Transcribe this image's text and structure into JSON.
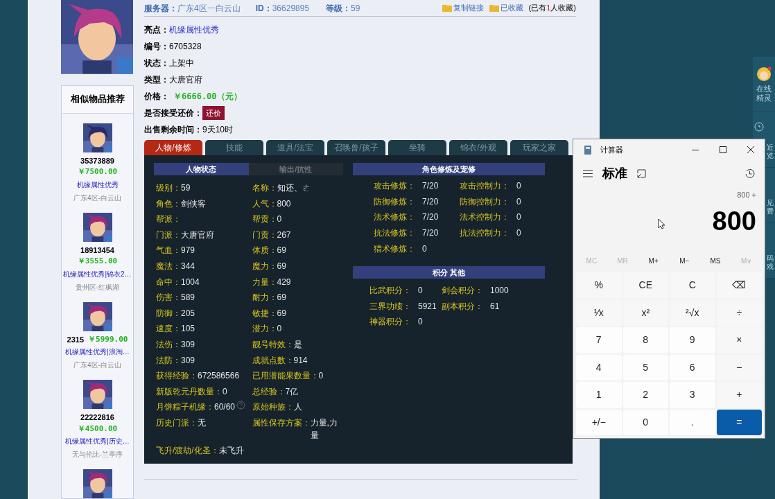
{
  "header": {
    "server_label": "服务器：",
    "server": "广东4区一白云山",
    "id_label": "ID：",
    "id": "36629895",
    "level_label": "等级：",
    "level": "59",
    "links": [
      "复制链接",
      "已收藏"
    ],
    "collect_before": "(已有",
    "collect_count": "1",
    "collect_after": "人收藏)"
  },
  "details": [
    {
      "kind": "link",
      "label": "亮点：",
      "value": "机缘属性优秀"
    },
    {
      "kind": "text",
      "label": "编号：",
      "value": "6705328"
    },
    {
      "kind": "text",
      "label": "状态：",
      "value": "上架中"
    },
    {
      "kind": "text",
      "label": "类型：",
      "value": "大唐官府"
    },
    {
      "kind": "price",
      "label": "价格：",
      "value": "￥6666.00（元）"
    },
    {
      "kind": "button",
      "label": "是否接受还价：",
      "value": "还价"
    },
    {
      "kind": "text",
      "label": "出售剩余时间：",
      "value": "9天10时"
    }
  ],
  "tabs": [
    {
      "label": "人物/修炼",
      "selected": true
    },
    {
      "label": "技能",
      "selected": false
    },
    {
      "label": "道具/法宝",
      "selected": false
    },
    {
      "label": "召唤兽/孩子",
      "selected": false
    },
    {
      "label": "坐骑",
      "selected": false
    },
    {
      "label": "锦衣/外观",
      "selected": false
    },
    {
      "label": "玩家之家",
      "selected": false
    }
  ],
  "similar": {
    "title": "相似物品推荐",
    "items": [
      {
        "kind": "stacked",
        "id": "35373889",
        "price": "￥7500.00",
        "tags": "机缘属性优秀",
        "server": "广东4区-白云山"
      },
      {
        "kind": "stacked",
        "id": "18913454",
        "price": "￥3555.00",
        "tags": "机缘属性优秀|锦衣2…",
        "server": "贵州区-红枫湖"
      },
      {
        "kind": "inline",
        "id": "2315",
        "price": "￥5999.00",
        "tags": "机缘属性优秀|浪淘…",
        "server": "广东4区-白云山"
      },
      {
        "kind": "stacked",
        "id": "22222816",
        "price": "￥4500.00",
        "tags": "机缘属性优秀|历史…",
        "server": "无与伦比-兰亭序"
      },
      {
        "kind": "partial"
      }
    ]
  },
  "status": {
    "tabs": [
      {
        "label": "人物状态",
        "selected": true
      },
      {
        "label": "输出/抗性",
        "selected": false
      }
    ],
    "fields": [
      {
        "label": "级别：",
        "value": "59"
      },
      {
        "label": "名称：",
        "value": "知还、ㄜ"
      },
      {
        "label": "角色：",
        "value": "剑侠客"
      },
      {
        "label": "人气：",
        "value": "800"
      },
      {
        "label": "帮派："
      },
      {
        "label": "帮贡：",
        "value": "0"
      },
      {
        "label": "门派：",
        "value": "大唐官府"
      },
      {
        "label": "门贡：",
        "value": "267"
      },
      {
        "label": "气血：",
        "value": "979"
      },
      {
        "label": "体质：",
        "value": "69"
      },
      {
        "label": "魔法：",
        "value": "344"
      },
      {
        "label": "魔力：",
        "value": "69"
      },
      {
        "label": "命中：",
        "value": "1004"
      },
      {
        "label": "力量：",
        "value": "429"
      },
      {
        "label": "伤害：",
        "value": "589"
      },
      {
        "label": "耐力：",
        "value": "69"
      },
      {
        "label": "防御：",
        "value": "205"
      },
      {
        "label": "敏捷：",
        "value": "69"
      },
      {
        "label": "速度：",
        "value": "105"
      },
      {
        "label": "潜力：",
        "value": "0"
      },
      {
        "label": "法伤：",
        "value": "309"
      },
      {
        "label": "靓号特效：",
        "value": "是"
      },
      {
        "label": "法防：",
        "value": "309"
      },
      {
        "label": "成就点数：",
        "value": "914"
      },
      {
        "label": "获得经验：",
        "value": "672586566"
      },
      {
        "label": "已用潜能果数量：",
        "value": "0"
      },
      {
        "label": "新版乾元丹数量：",
        "value": "0"
      },
      {
        "label": "总经验：",
        "value": "7亿"
      },
      {
        "label": "月饼粽子机缘：",
        "value": "60/60",
        "help": true
      },
      {
        "label": "原始种族：",
        "value": "人"
      },
      {
        "label": "历史门派：",
        "value": "无"
      },
      {
        "label": "属性保存方案：",
        "value": "力量,力量"
      },
      {
        "label": "飞升/渡劫/化圣：",
        "value": "未飞升",
        "wide": true
      }
    ]
  },
  "cultivation": {
    "title": "角色修炼及宠修",
    "fields": [
      {
        "label": "攻击修炼：",
        "value": "7/20"
      },
      {
        "label": "攻击控制力：",
        "value": "0"
      },
      {
        "label": "防御修炼：",
        "value": "7/20"
      },
      {
        "label": "防御控制力：",
        "value": "0"
      },
      {
        "label": "法术修炼：",
        "value": "7/20"
      },
      {
        "label": "法术控制力：",
        "value": "0"
      },
      {
        "label": "抗法修炼：",
        "value": "7/20"
      },
      {
        "label": "抗法控制力：",
        "value": "0"
      },
      {
        "label": "猎术修炼：",
        "value": "0"
      }
    ]
  },
  "points": {
    "title": "积分 其他",
    "fields": [
      {
        "label": "比武积分：",
        "value": "0"
      },
      {
        "label": "剑会积分：",
        "value": "1000"
      },
      {
        "label": "三界功绩：",
        "value": "5921"
      },
      {
        "label": "副本积分：",
        "value": "61"
      },
      {
        "label": "神器积分：",
        "value": "0"
      }
    ]
  },
  "side_panel": [
    {
      "label": "在线精灵",
      "kind": "avatar"
    },
    {
      "label": "近览",
      "kind": "clock"
    },
    {
      "label": "见费",
      "kind": "bracket"
    },
    {
      "label": "码戏",
      "kind": "bracket"
    }
  ],
  "calculator": {
    "title": "计算器",
    "mode": "标准",
    "expression": "800 +",
    "display": "800",
    "memory": [
      {
        "label": "MC",
        "disabled": true
      },
      {
        "label": "MR",
        "disabled": true
      },
      {
        "label": "M+",
        "disabled": false
      },
      {
        "label": "M−",
        "disabled": false
      },
      {
        "label": "MS",
        "disabled": false
      },
      {
        "label": "M∨",
        "disabled": true
      }
    ],
    "keys": [
      {
        "label": "%",
        "kind": "op"
      },
      {
        "label": "CE",
        "kind": "op"
      },
      {
        "label": "C",
        "kind": "op"
      },
      {
        "label": "⌫",
        "kind": "op"
      },
      {
        "label": "¹⁄x",
        "kind": "op"
      },
      {
        "label": "x²",
        "kind": "op"
      },
      {
        "label": "²√x",
        "kind": "op"
      },
      {
        "label": "÷",
        "kind": "op"
      },
      {
        "label": "7",
        "kind": "digit"
      },
      {
        "label": "8",
        "kind": "digit"
      },
      {
        "label": "9",
        "kind": "digit"
      },
      {
        "label": "×",
        "kind": "op"
      },
      {
        "label": "4",
        "kind": "digit"
      },
      {
        "label": "5",
        "kind": "digit"
      },
      {
        "label": "6",
        "kind": "digit"
      },
      {
        "label": "−",
        "kind": "op"
      },
      {
        "label": "1",
        "kind": "digit"
      },
      {
        "label": "2",
        "kind": "digit"
      },
      {
        "label": "3",
        "kind": "digit"
      },
      {
        "label": "+",
        "kind": "op"
      },
      {
        "label": "+/−",
        "kind": "digit"
      },
      {
        "label": "0",
        "kind": "digit"
      },
      {
        "label": ".",
        "kind": "digit"
      },
      {
        "label": "=",
        "kind": "equals"
      }
    ]
  }
}
